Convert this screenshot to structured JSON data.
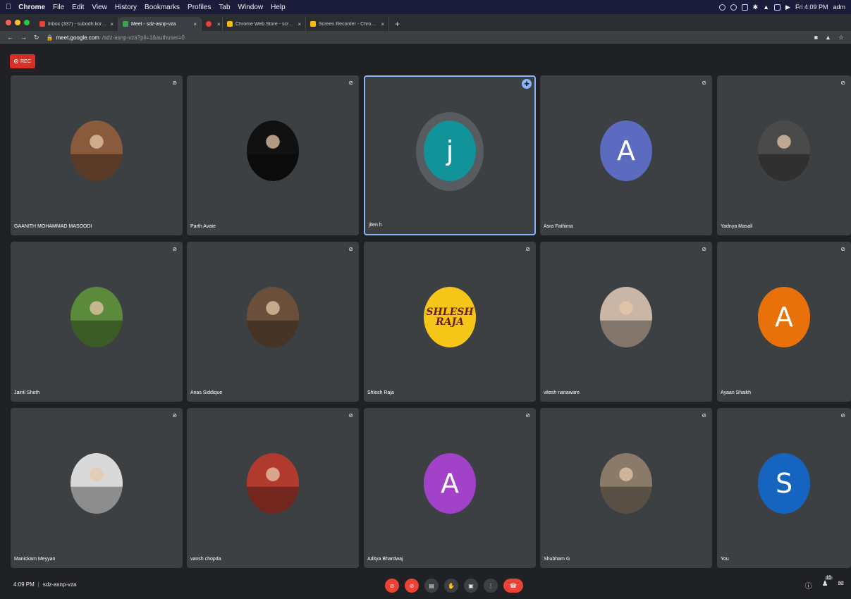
{
  "menubar": {
    "items": [
      "Chrome",
      "File",
      "Edit",
      "View",
      "History",
      "Bookmarks",
      "Profiles",
      "Tab",
      "Window",
      "Help"
    ],
    "clock": "Fri 4:09 PM",
    "user": "adm"
  },
  "tabs": [
    {
      "label": "Inbox (337) - subodh.korgaon",
      "color": "#ea4335"
    },
    {
      "label": "Meet - sdz-asnp-vza",
      "color": "#34a853",
      "active": true
    },
    {
      "label": "",
      "color": "#ea4335"
    },
    {
      "label": "Chrome Web Store - screen re",
      "color": "#fbbc04"
    },
    {
      "label": "Screen Recorder - Chrome We",
      "color": "#fbbc04"
    }
  ],
  "address": {
    "host": "meet.google.com",
    "path": "/sdz-asnp-vza?pli=1&authuser=0"
  },
  "rec": {
    "label": "REC"
  },
  "participants": [
    {
      "name": "GAANITH MOHAMMAD MASOODI",
      "avatar_type": "photo",
      "bg": "#8a5a3c"
    },
    {
      "name": "Parth Avate",
      "avatar_type": "photo",
      "bg": "#111111"
    },
    {
      "name": "jiten h",
      "avatar_type": "letter",
      "letter": "j",
      "bg": "#12939a",
      "active": true
    },
    {
      "name": "Asra Fathima",
      "avatar_type": "letter",
      "letter": "A",
      "bg": "#5c6bc0"
    },
    {
      "name": "Yadnya Masali",
      "avatar_type": "photo",
      "bg": "#4a4a4a"
    },
    {
      "name": "Jainil Sheth",
      "avatar_type": "photo",
      "bg": "#5b8a3a"
    },
    {
      "name": "Anas Siddique",
      "avatar_type": "photo",
      "bg": "#6b4f3a"
    },
    {
      "name": "Shlesh Raja",
      "avatar_type": "photo_text",
      "photo_text": "SHLESH RAJA",
      "bg": "#f5c518"
    },
    {
      "name": "vitesh nanaware",
      "avatar_type": "photo",
      "bg": "#c9b6a6"
    },
    {
      "name": "Ayaan Shaikh",
      "avatar_type": "letter",
      "letter": "A",
      "bg": "#e8710a"
    },
    {
      "name": "Manickam Meyyan",
      "avatar_type": "photo",
      "bg": "#d9d9d9"
    },
    {
      "name": "vansh chopda",
      "avatar_type": "photo",
      "bg": "#b03a2e"
    },
    {
      "name": "Aditya Bhardwaj",
      "avatar_type": "letter",
      "letter": "A",
      "bg": "#a142c8"
    },
    {
      "name": "Shubham G",
      "avatar_type": "photo",
      "bg": "#8a7a6a"
    },
    {
      "name": "You",
      "avatar_type": "letter",
      "letter": "S",
      "bg": "#1565c0"
    }
  ],
  "bottom": {
    "time": "4:09 PM",
    "separator": "|",
    "meeting_code": "sdz-asnp-vza",
    "participant_count": "15"
  }
}
